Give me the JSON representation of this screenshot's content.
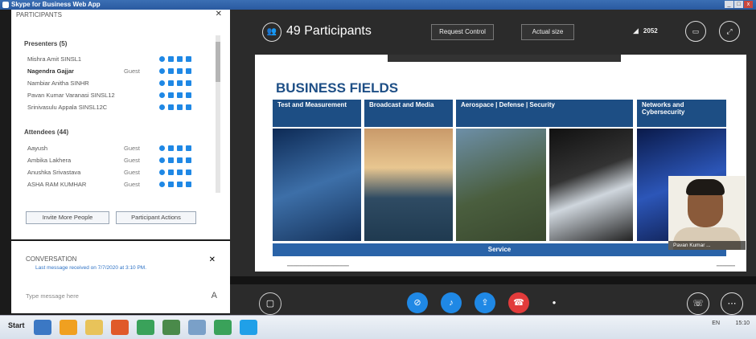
{
  "window": {
    "title": "Skype for Business Web App"
  },
  "participants_panel": {
    "header": "PARTICIPANTS",
    "presenters_heading": "Presenters (5)",
    "presenters": [
      {
        "name": "Mishra Amit SINSL1",
        "tag": ""
      },
      {
        "name": "Nagendra Gajjar",
        "tag": "Guest"
      },
      {
        "name": "Nambiar Anitha SINHR",
        "tag": ""
      },
      {
        "name": "Pavan Kumar Varanasi SINSL12",
        "tag": ""
      },
      {
        "name": "Srinivasulu Appala SINSL12C",
        "tag": ""
      }
    ],
    "attendees_heading": "Attendees (44)",
    "attendees": [
      {
        "name": "Aayush",
        "tag": "Guest"
      },
      {
        "name": "Ambika Lakhera",
        "tag": "Guest"
      },
      {
        "name": "Anushka Srivastava",
        "tag": "Guest"
      },
      {
        "name": "ASHA RAM KUMHAR",
        "tag": "Guest"
      }
    ],
    "invite_button": "Invite More People",
    "actions_button": "Participant Actions"
  },
  "conversation": {
    "header": "CONVERSATION",
    "last_message": "Last message received on 7/7/2020 at 3:10 PM.",
    "placeholder": "Type message here"
  },
  "stage": {
    "participant_count": "49 Participants",
    "request_control": "Request Control",
    "actual_size": "Actual size",
    "signal_value": "2052"
  },
  "slide": {
    "title": "BUSINESS FIELDS",
    "fields": [
      "Test and Measurement",
      "Broadcast and Media",
      "Aerospace | Defense | Security",
      "Networks and Cybersecurity"
    ],
    "service": "Service"
  },
  "video": {
    "name": "Pavan Kumar ..."
  },
  "taskbar": {
    "start": "Start",
    "lang": "EN",
    "time": "15:10"
  },
  "colors": {
    "accent": "#1f88e5",
    "slide_blue": "#1d4e84",
    "hangup": "#e23b3b"
  }
}
